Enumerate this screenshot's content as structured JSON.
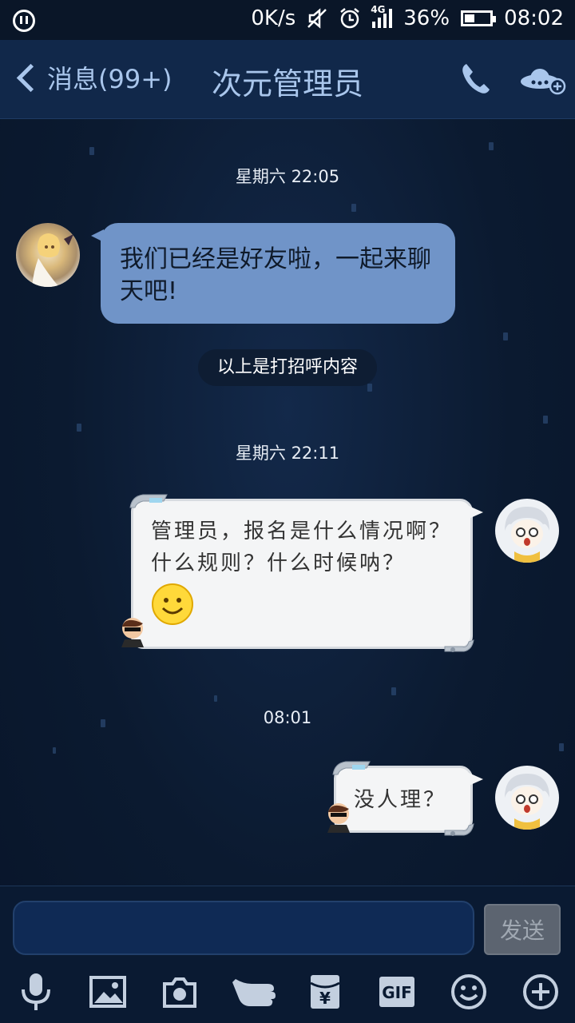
{
  "status_bar": {
    "network_speed": "0K/s",
    "network_type": "4G",
    "battery": "36%",
    "battery_level": 0.36,
    "time": "08:02"
  },
  "header": {
    "back_label": "消息(99+)",
    "title": "次元管理员"
  },
  "messages": [
    {
      "type": "time",
      "text": "星期六 22:05"
    },
    {
      "type": "incoming",
      "text": "我们已经是好友啦，一起来聊天吧!"
    },
    {
      "type": "system",
      "text": "以上是打招呼内容"
    },
    {
      "type": "time",
      "text": "星期六 22:11"
    },
    {
      "type": "outgoing",
      "text": "管理员，报名是什么情况啊？什么规则？什么时候呐？",
      "emoji": "smile-emoji"
    },
    {
      "type": "time",
      "text": "08:01"
    },
    {
      "type": "outgoing",
      "text": "没人理？"
    }
  ],
  "input": {
    "value": "",
    "send_label": "发送"
  },
  "toolbar": {
    "gif_label": "GIF",
    "yen_label": "¥",
    "items": [
      "microphone-icon",
      "image-icon",
      "camera-icon",
      "poke-icon",
      "red-packet-icon",
      "gif-icon",
      "emoji-icon",
      "plus-icon"
    ]
  },
  "colors": {
    "header_text": "#a9c6ec",
    "incoming_bubble": "#7094c8",
    "outgoing_bubble": "#f4f5f6",
    "background": "#0b1a30"
  }
}
